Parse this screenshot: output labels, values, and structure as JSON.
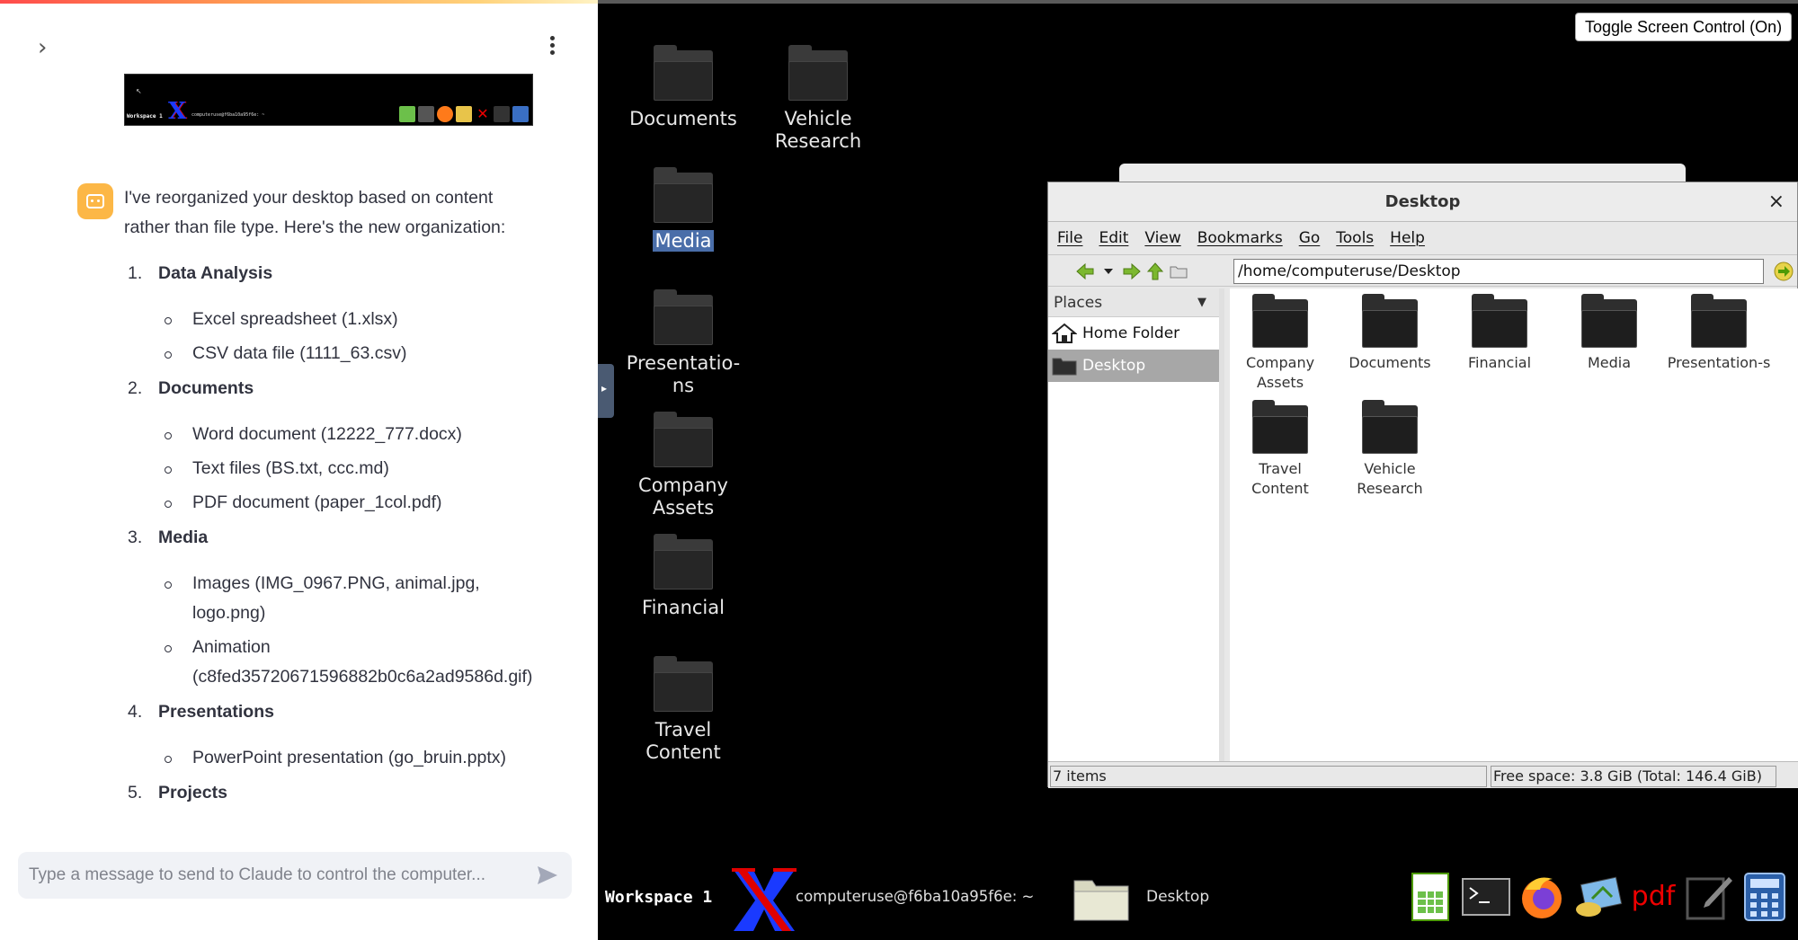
{
  "chat": {
    "message": {
      "intro": "I've reorganized your desktop based on content rather than file type. Here's the new organization:",
      "categories": [
        {
          "num": "1.",
          "name": "Data Analysis",
          "items": [
            "Excel spreadsheet (1.xlsx)",
            "CSV data file (1111_63.csv)"
          ]
        },
        {
          "num": "2.",
          "name": "Documents",
          "items": [
            "Word document (12222_777.docx)",
            "Text files (BS.txt, ccc.md)",
            "PDF document (paper_1col.pdf)"
          ]
        },
        {
          "num": "3.",
          "name": "Media",
          "items": [
            "Images (IMG_0967.PNG, animal.jpg, logo.png)",
            "Animation (c8fed35720671596882b0c6a2ad9586d.gif)"
          ]
        },
        {
          "num": "4.",
          "name": "Presentations",
          "items": [
            "PowerPoint presentation (go_bruin.pptx)"
          ]
        },
        {
          "num": "5.",
          "name": "Projects",
          "items": []
        }
      ]
    },
    "input": {
      "placeholder": "Type a message to send to Claude to control the computer..."
    },
    "thumbnail": {
      "workspace": "Workspace 1",
      "user": "computeruse@f6ba10a95f6e: ~"
    }
  },
  "desktop": {
    "toggle_label": "Toggle Screen Control (On)",
    "icons": [
      {
        "label": "Documents"
      },
      {
        "label": "Vehicle Research"
      },
      {
        "label": "Media"
      },
      {
        "label": "Presentatio-ns"
      },
      {
        "label": "Company Assets"
      },
      {
        "label": "Financial"
      },
      {
        "label": "Travel Content"
      }
    ],
    "file_manager": {
      "title": "Desktop",
      "close": "×",
      "menu": [
        "File",
        "Edit",
        "View",
        "Bookmarks",
        "Go",
        "Tools",
        "Help"
      ],
      "location": "/home/computeruse/Desktop",
      "places_header": "Places",
      "places": [
        {
          "label": "Home Folder",
          "icon": "home-icon"
        },
        {
          "label": "Desktop",
          "icon": "folder-icon"
        }
      ],
      "files": [
        {
          "label": "Company Assets"
        },
        {
          "label": "Documents"
        },
        {
          "label": "Financial"
        },
        {
          "label": "Media"
        },
        {
          "label": "Presentation-s"
        },
        {
          "label": "Travel Content"
        },
        {
          "label": "Vehicle Research"
        }
      ],
      "status_left": "7 items",
      "status_right": "Free space: 3.8 GiB (Total: 146.4 GiB)"
    },
    "taskbar": {
      "workspace": "Workspace 1",
      "terminal_title": "computeruse@f6ba10a95f6e: ~",
      "task_desktop": "Desktop",
      "pdf_label": "pdf"
    }
  },
  "colors": {
    "accent": "#fcb746",
    "desktop_bg": "#000000",
    "selection": "#4a6ea9"
  }
}
